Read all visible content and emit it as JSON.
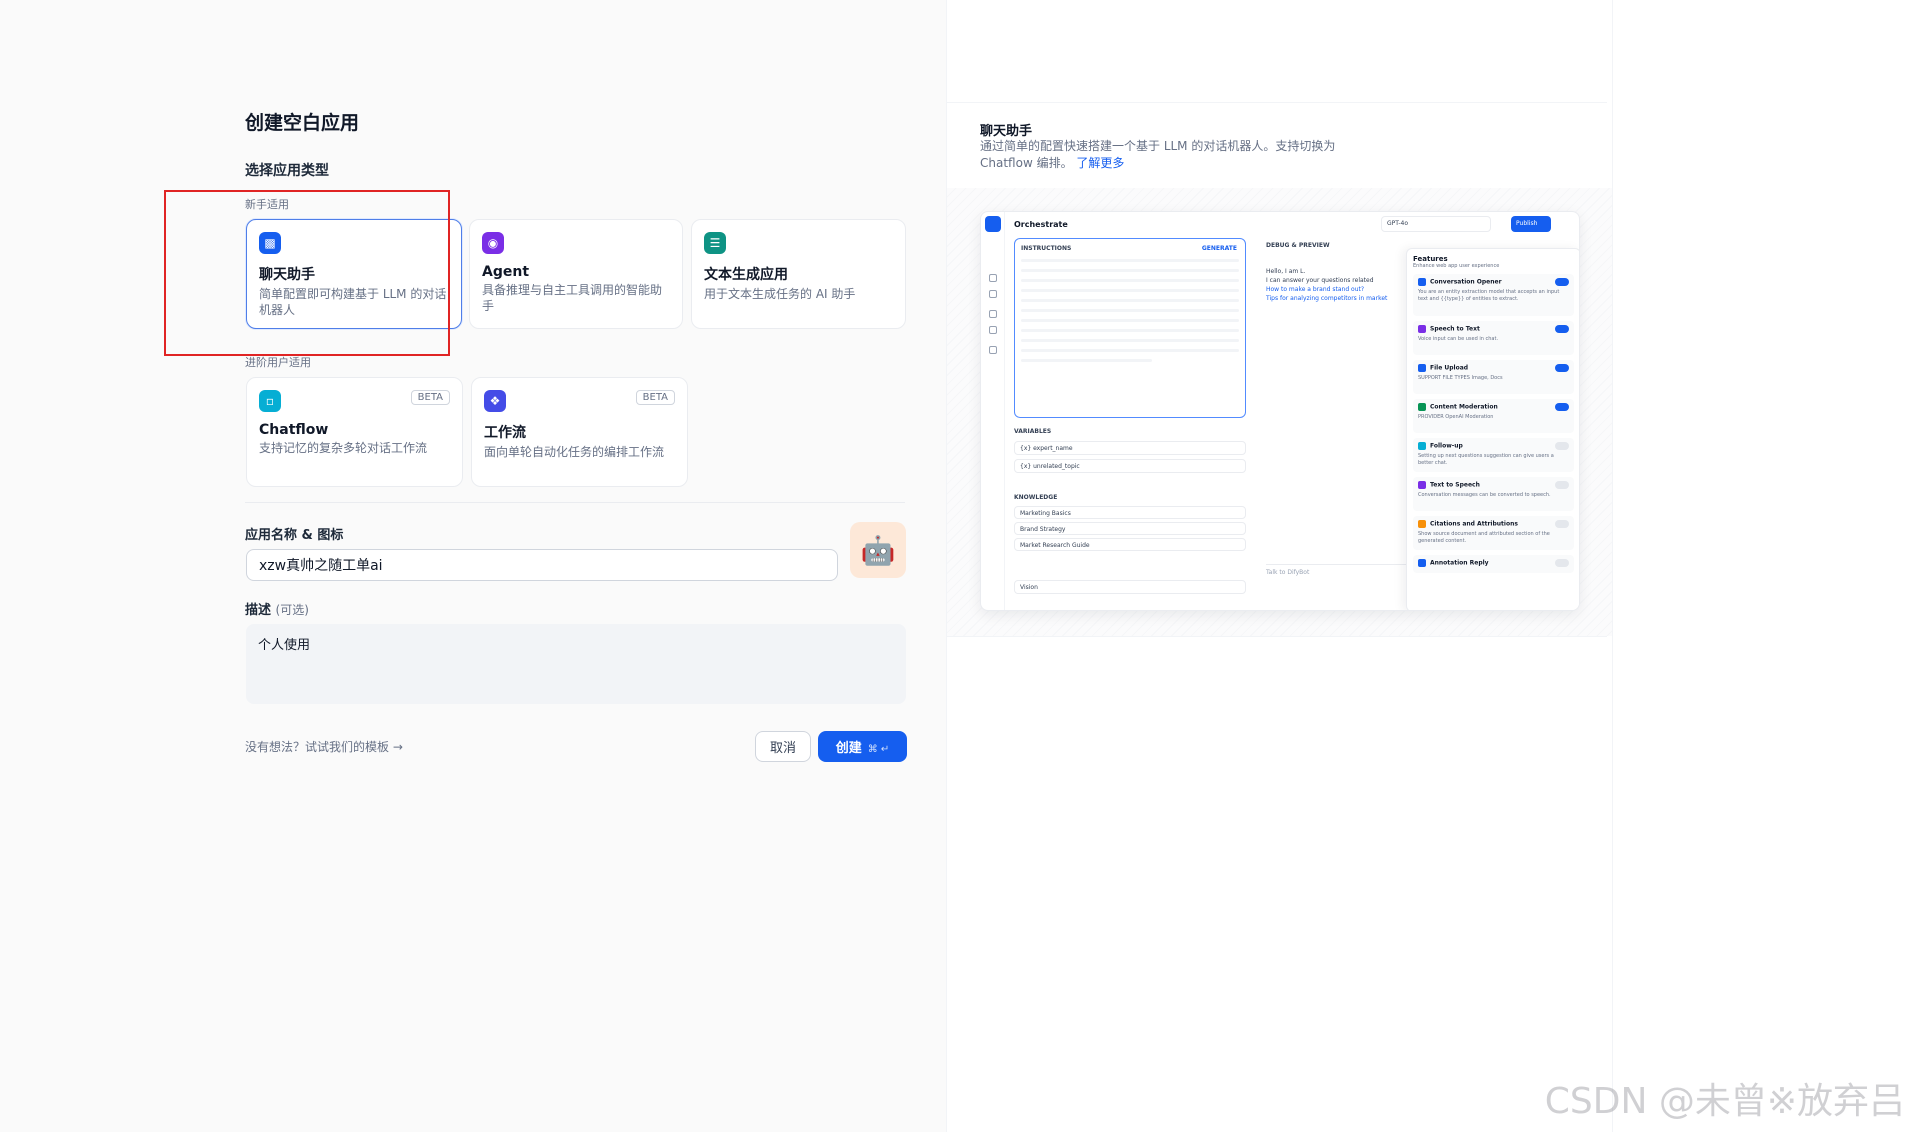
{
  "page": {
    "title": "创建空白应用",
    "section_title": "选择应用类型",
    "group_beginner": "新手适用",
    "group_advanced": "进阶用户适用"
  },
  "app_types": [
    {
      "title": "聊天助手",
      "desc": "简单配置即可构建基于 LLM 的对话机器人",
      "icon": "chat-bot-icon",
      "color": "#155eef"
    },
    {
      "title": "Agent",
      "desc": "具备推理与自主工具调用的智能助手",
      "icon": "agent-icon",
      "color": "#7a2ee6"
    },
    {
      "title": "文本生成应用",
      "desc": "用于文本生成任务的 AI 助手",
      "icon": "text-generation-icon",
      "color": "#0e9384"
    },
    {
      "title": "Chatflow",
      "desc": "支持记忆的复杂多轮对话工作流",
      "icon": "chatflow-icon",
      "color": "#06aed4",
      "badge": "BETA"
    },
    {
      "title": "工作流",
      "desc": "面向单轮自动化任务的编排工作流",
      "icon": "workflow-icon",
      "color": "#444ce7",
      "badge": "BETA"
    }
  ],
  "form": {
    "name_label": "应用名称 & 图标",
    "name_value": "xzw真帅之随工单ai",
    "desc_label": "描述",
    "desc_optional": "(可选)",
    "desc_value": "个人使用",
    "hint": "没有想法？试试我们的模板 →",
    "cancel": "取消",
    "create": "创建",
    "create_kbd": "⌘ ↵"
  },
  "preview": {
    "title": "聊天助手",
    "desc": "通过简单的配置快速搭建一个基于 LLM 的对话机器人。支持切换为 Chatflow 编排。",
    "learn_more": "了解更多",
    "mock": {
      "header": "Orchestrate",
      "model": "GPT-4o",
      "publish": "Publish",
      "instructions": "INSTRUCTIONS",
      "generate": "GENERATE",
      "variables": "VARIABLES",
      "var_rows": [
        "{x} expert_name",
        "{x} unrelated_topic"
      ],
      "knowledge": "KNOWLEDGE",
      "kb_rows": [
        "Marketing Basics",
        "Brand Strategy",
        "Market Research Guide"
      ],
      "vision": "Vision",
      "debug": "DEBUG & PREVIEW",
      "chat_line1": "Hello, I am L.",
      "chat_line2": "I can answer your questions related",
      "chat_sug1": "How to make a brand stand out?",
      "chat_sug2": "Tips for analyzing competitors in market",
      "talk": "Talk to DifyBot",
      "features_title": "Features",
      "features_sub": "Enhance web app user experience",
      "features": [
        {
          "name": "Conversation Opener",
          "desc": "You are an entity extraction model that accepts an input text and {{type}} of entities to extract.",
          "on": true
        },
        {
          "name": "Speech to Text",
          "desc": "Voice input can be used in chat.",
          "on": true
        },
        {
          "name": "File Upload",
          "desc": "SUPPORT FILE TYPES  Image, Docs",
          "on": true
        },
        {
          "name": "Content Moderation",
          "desc": "PROVIDER  OpenAI Moderation",
          "on": true
        },
        {
          "name": "Follow-up",
          "desc": "Setting up next questions suggestion can give users a better chat.",
          "on": false
        },
        {
          "name": "Text to Speech",
          "desc": "Conversation messages can be converted to speech.",
          "on": false
        },
        {
          "name": "Citations and Attributions",
          "desc": "Show source document and attributed section of the generated content.",
          "on": false
        },
        {
          "name": "Annotation Reply",
          "desc": "",
          "on": false
        }
      ]
    }
  },
  "watermark": "CSDN @未曾※放弃吕"
}
